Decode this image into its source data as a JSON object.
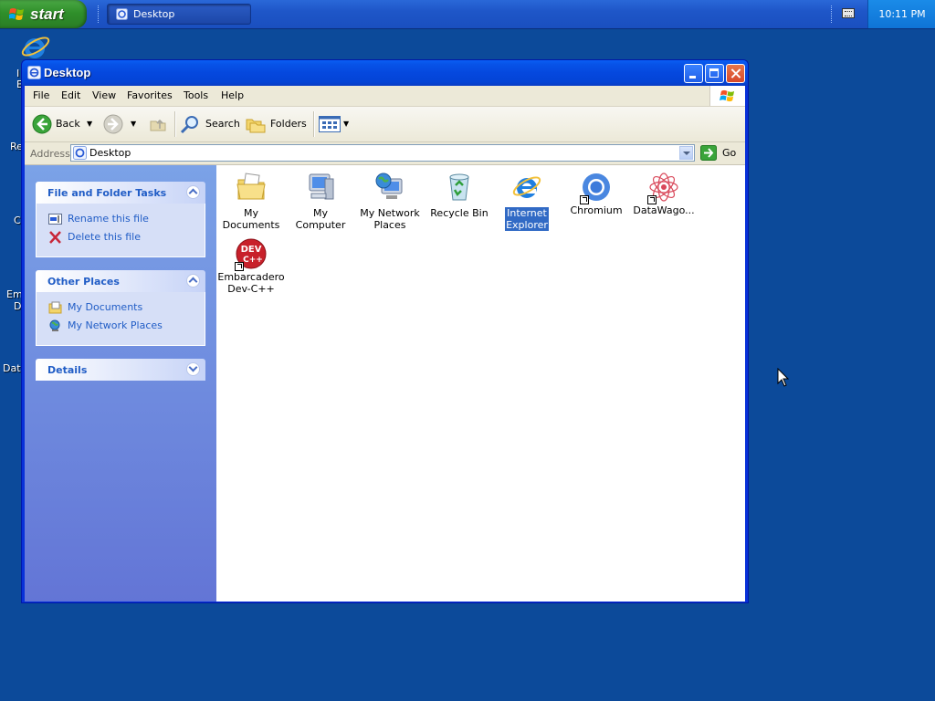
{
  "taskbar": {
    "start_label": "start",
    "task_button_label": "Desktop",
    "clock": "10:11 PM"
  },
  "desktop": {
    "partial_labels": [
      "I",
      "E",
      "Re",
      "C",
      "Em",
      "D",
      "Dat"
    ]
  },
  "window": {
    "title": "Desktop",
    "menu": [
      "File",
      "Edit",
      "View",
      "Favorites",
      "Tools",
      "Help"
    ],
    "toolbar": {
      "back": "Back",
      "search": "Search",
      "folders": "Folders"
    },
    "address": {
      "label": "Address",
      "value": "Desktop",
      "go": "Go"
    },
    "task_panels": {
      "file_tasks": {
        "title": "File and Folder Tasks",
        "links": [
          "Rename this file",
          "Delete this file"
        ]
      },
      "other_places": {
        "title": "Other Places",
        "links": [
          "My Documents",
          "My Network Places"
        ]
      },
      "details": {
        "title": "Details"
      }
    },
    "items": [
      {
        "name_lines": [
          "My Documents"
        ],
        "icon": "my-documents-icon"
      },
      {
        "name_lines": [
          "My Computer"
        ],
        "icon": "my-computer-icon"
      },
      {
        "name_lines": [
          "My Network",
          "Places"
        ],
        "icon": "network-places-icon"
      },
      {
        "name_lines": [
          "Recycle Bin"
        ],
        "icon": "recycle-bin-icon"
      },
      {
        "name_lines": [
          "Internet",
          "Explorer"
        ],
        "icon": "internet-explorer-icon",
        "selected": true
      },
      {
        "name_lines": [
          "Chromium"
        ],
        "icon": "chromium-icon",
        "shortcut": true
      },
      {
        "name_lines": [
          "DataWago..."
        ],
        "icon": "datawagon-icon",
        "shortcut": true
      },
      {
        "name_lines": [
          "Embarcadero",
          "Dev-C++"
        ],
        "icon": "devcpp-icon",
        "shortcut": true,
        "badge": "DEV C++"
      }
    ]
  },
  "colors": {
    "desktop": "#0c4a9a",
    "titlebar": "#0548de",
    "taskpane": "#7ba2e7",
    "link": "#215dc6",
    "selection": "#316ac5"
  }
}
